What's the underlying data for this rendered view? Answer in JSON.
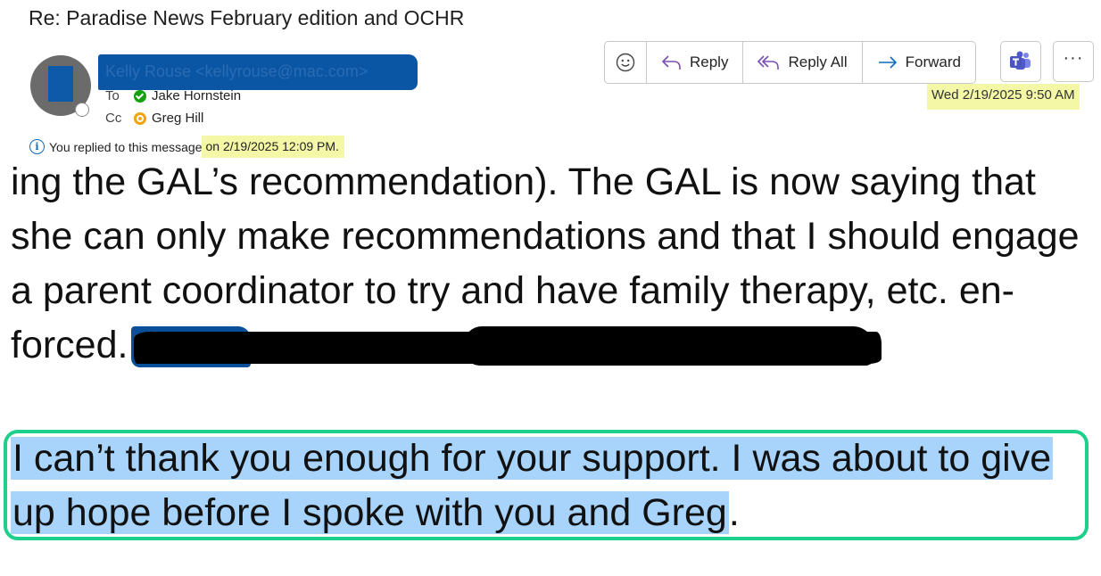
{
  "email": {
    "subject": "Re: Paradise News February edition and OCHR",
    "sender": "Kelly Rouse <kellyrouse@mac.com>",
    "to_label": "To",
    "to_name": "Jake Hornstein",
    "cc_label": "Cc",
    "cc_name": "Greg Hill",
    "info_prefix": "You replied to this message ",
    "info_date": "on 2/19/2025 12:09 PM.",
    "received": "Wed 2/19/2025 9:50 AM"
  },
  "toolbar": {
    "emoji_icon": "smiley-icon",
    "reply_label": "Reply",
    "reply_all_label": "Reply All",
    "forward_label": "Forward",
    "teams_icon": "teams-icon",
    "more_label": "···"
  },
  "body": {
    "lines": [
      "ing the GAL’s recommendation). The GAL is now saying that",
      "she can only make recommendations and that I should engage",
      "a parent coordinator to try and have family therapy, etc. en-",
      "forced."
    ],
    "quote_lines": [
      "I can’t thank you enough for your support. I was about to give",
      "up hope before I spoke with you and Greg"
    ],
    "quote_tail": "."
  },
  "colors": {
    "highlight_yellow": "#f3f7a6",
    "highlight_blue": "#a8d4fb",
    "box_green": "#1fd08c",
    "redaction_blue": "#0a56a4"
  }
}
